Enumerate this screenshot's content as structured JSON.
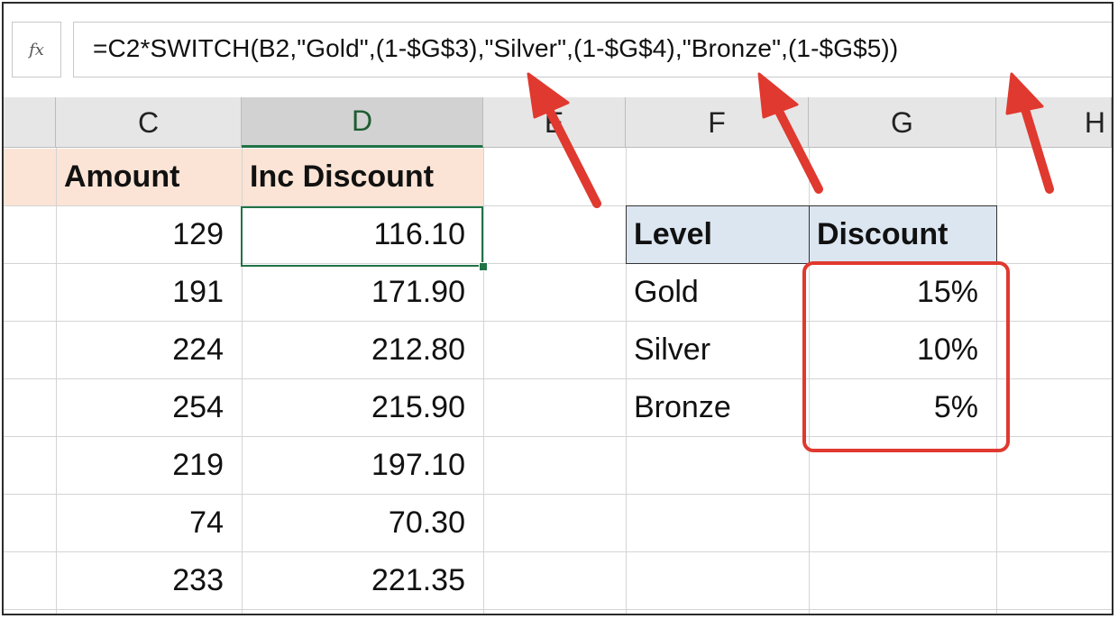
{
  "formula_bar": {
    "fx_label": "fx",
    "formula": "=C2*SWITCH(B2,\"Gold\",(1-$G$3),\"Silver\",(1-$G$4),\"Bronze\",(1-$G$5))"
  },
  "columns": [
    "C",
    "D",
    "E",
    "F",
    "G",
    "H"
  ],
  "main_table": {
    "headers": [
      "Amount",
      "Inc Discount"
    ],
    "rows": [
      [
        "129",
        "116.10"
      ],
      [
        "191",
        "171.90"
      ],
      [
        "224",
        "212.80"
      ],
      [
        "254",
        "215.90"
      ],
      [
        "219",
        "197.10"
      ],
      [
        "74",
        "70.30"
      ],
      [
        "233",
        "221.35"
      ]
    ]
  },
  "discount_table": {
    "headers": [
      "Level",
      "Discount"
    ],
    "rows": [
      [
        "Gold",
        "15%"
      ],
      [
        "Silver",
        "10%"
      ],
      [
        "Bronze",
        "5%"
      ]
    ]
  },
  "colors": {
    "annotation_red": "#e0392f",
    "excel_green": "#217346",
    "header_peach": "#fbe4d5",
    "header_blue": "#dce6f1"
  }
}
